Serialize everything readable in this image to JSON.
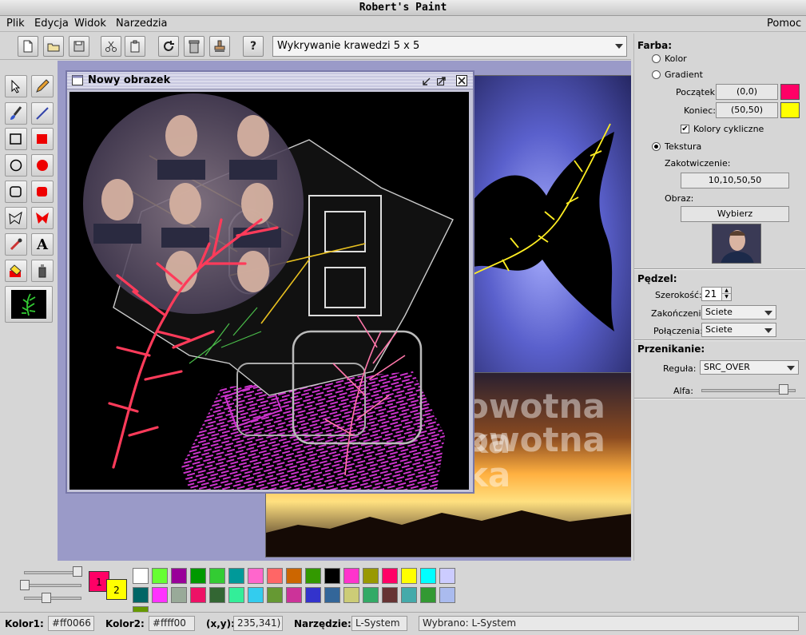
{
  "app": {
    "title": "Robert's Paint"
  },
  "menu": {
    "file": "Plik",
    "edit": "Edycja",
    "view": "Widok",
    "tools": "Narzedzia",
    "help": "Pomoc"
  },
  "toolbar": {
    "filter_selected": "Wykrywanie krawedzi 5 x 5",
    "help_label": "?"
  },
  "canvas_window": {
    "title": "Nowy obrazek"
  },
  "background_images": {
    "text_overlay_1": "owotna ka",
    "text_overlay_2": "owotna ka"
  },
  "paint": {
    "section_title": "Farba:",
    "options": {
      "color": "Kolor",
      "gradient": "Gradient",
      "texture": "Tekstura"
    },
    "start_label": "Początek:",
    "start_value": "(0,0)",
    "start_color": "#ff0066",
    "end_label": "Koniec:",
    "end_value": "(50,50)",
    "end_color": "#ffff00",
    "cyclic_label": "Kolory cykliczne",
    "anchor_label": "Zakotwiczenie:",
    "anchor_value": "10,10,50,50",
    "image_label": "Obraz:",
    "choose_button": "Wybierz",
    "selected_option": "Tekstura"
  },
  "brush": {
    "section_title": "Pędzel:",
    "width_label": "Szerokość:",
    "width_value": "21",
    "caps_label": "Zakończenia:",
    "caps_value": "Sciete",
    "joins_label": "Połączenia:",
    "joins_value": "Sciete"
  },
  "composite": {
    "section_title": "Przenikanie:",
    "rule_label": "Reguła:",
    "rule_value": "SRC_OVER",
    "alpha_label": "Alfa:",
    "alpha_level": 0.87
  },
  "color_slots": {
    "primary_label": "1",
    "secondary_label": "2",
    "primary": "#ff0066",
    "secondary": "#ffff00"
  },
  "palette": [
    "#ffffff",
    "#66ff33",
    "#990099",
    "#009900",
    "#33cc33",
    "#009999",
    "#ff66cc",
    "#ff6666",
    "#cc6600",
    "#339900",
    "#000000",
    "#ff33cc",
    "#999900",
    "#ff0066",
    "#ffff00",
    "#00ffff",
    "#ccccff",
    "#006666",
    "#ff33ff",
    "#99aa99",
    "#ee1166",
    "#336633",
    "#33ee99",
    "#33ccee",
    "#669933",
    "#cc3399",
    "#3333cc",
    "#336699",
    "#cccc77",
    "#33aa66",
    "#663333",
    "#44aaaa",
    "#339933",
    "#aabbee",
    "#669900"
  ],
  "status": {
    "color1_label": "Kolor1:",
    "color1_value": "#ff0066",
    "color2_label": "Kolor2:",
    "color2_value": "#ffff00",
    "xy_label": "(x,y):",
    "xy_value": "235,341)",
    "tool_label": "Narzędzie:",
    "tool_value": "L-System",
    "selected_value": "Wybrano: L-System"
  }
}
